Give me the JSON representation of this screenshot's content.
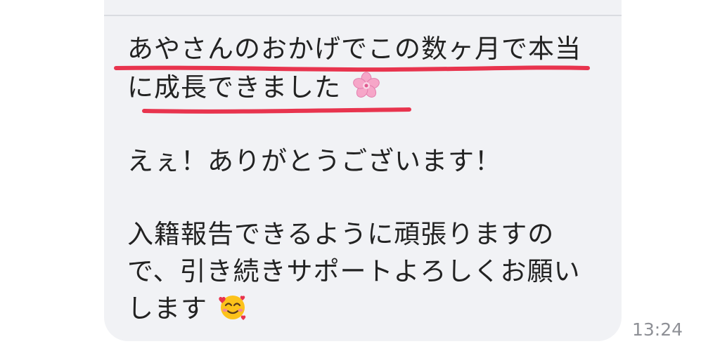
{
  "message": {
    "lines": [
      "あやさんのおかげでこの数ヶ月で本当",
      "に成長できました",
      "えぇ！ありがとうございます！",
      "入籍報告できるように頑張りますの",
      "で、引き続きサポートよろしくお願い",
      "します"
    ],
    "emoji_1": "cherry-blossom-emoji",
    "emoji_2": "smiling-face-with-hearts-emoji"
  },
  "timestamp": "13:24",
  "colors": {
    "bubble": "#f1f2f5",
    "underline": "#e8344e",
    "text": "#222222",
    "timestamp": "#8e9096"
  }
}
